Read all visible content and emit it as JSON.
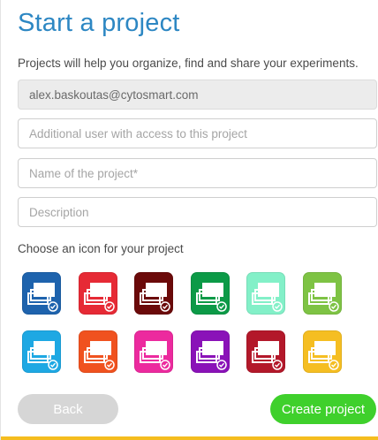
{
  "title": "Start a project",
  "subtitle": "Projects will help you organize, find and share your experiments.",
  "fields": {
    "owner_email": "alex.baskoutas@cytosmart.com",
    "additional_user_placeholder": "Additional user with access to this project",
    "project_name_placeholder": "Name of the project*",
    "description_placeholder": "Description"
  },
  "icon_section_label": "Choose an icon for your project",
  "icons": [
    {
      "name": "icon-blue-dark",
      "color": "#1e63ad"
    },
    {
      "name": "icon-red",
      "color": "#e62a35"
    },
    {
      "name": "icon-maroon",
      "color": "#6b0a0a"
    },
    {
      "name": "icon-green",
      "color": "#0c9a47"
    },
    {
      "name": "icon-mint",
      "color": "#83f0c8"
    },
    {
      "name": "icon-lime",
      "color": "#7ec344"
    },
    {
      "name": "icon-sky",
      "color": "#1ea8e3"
    },
    {
      "name": "icon-orange",
      "color": "#f0521f"
    },
    {
      "name": "icon-pink",
      "color": "#ec2a9e"
    },
    {
      "name": "icon-purple",
      "color": "#8a12b8"
    },
    {
      "name": "icon-crimson",
      "color": "#b3182a"
    },
    {
      "name": "icon-yellow",
      "color": "#f5be22"
    }
  ],
  "buttons": {
    "back": "Back",
    "create": "Create project"
  },
  "colors": {
    "accent": "#2d87c3",
    "create_button": "#3fd02c",
    "back_button": "#d6d6d6",
    "bottom_bar": "#f5bd1f"
  }
}
